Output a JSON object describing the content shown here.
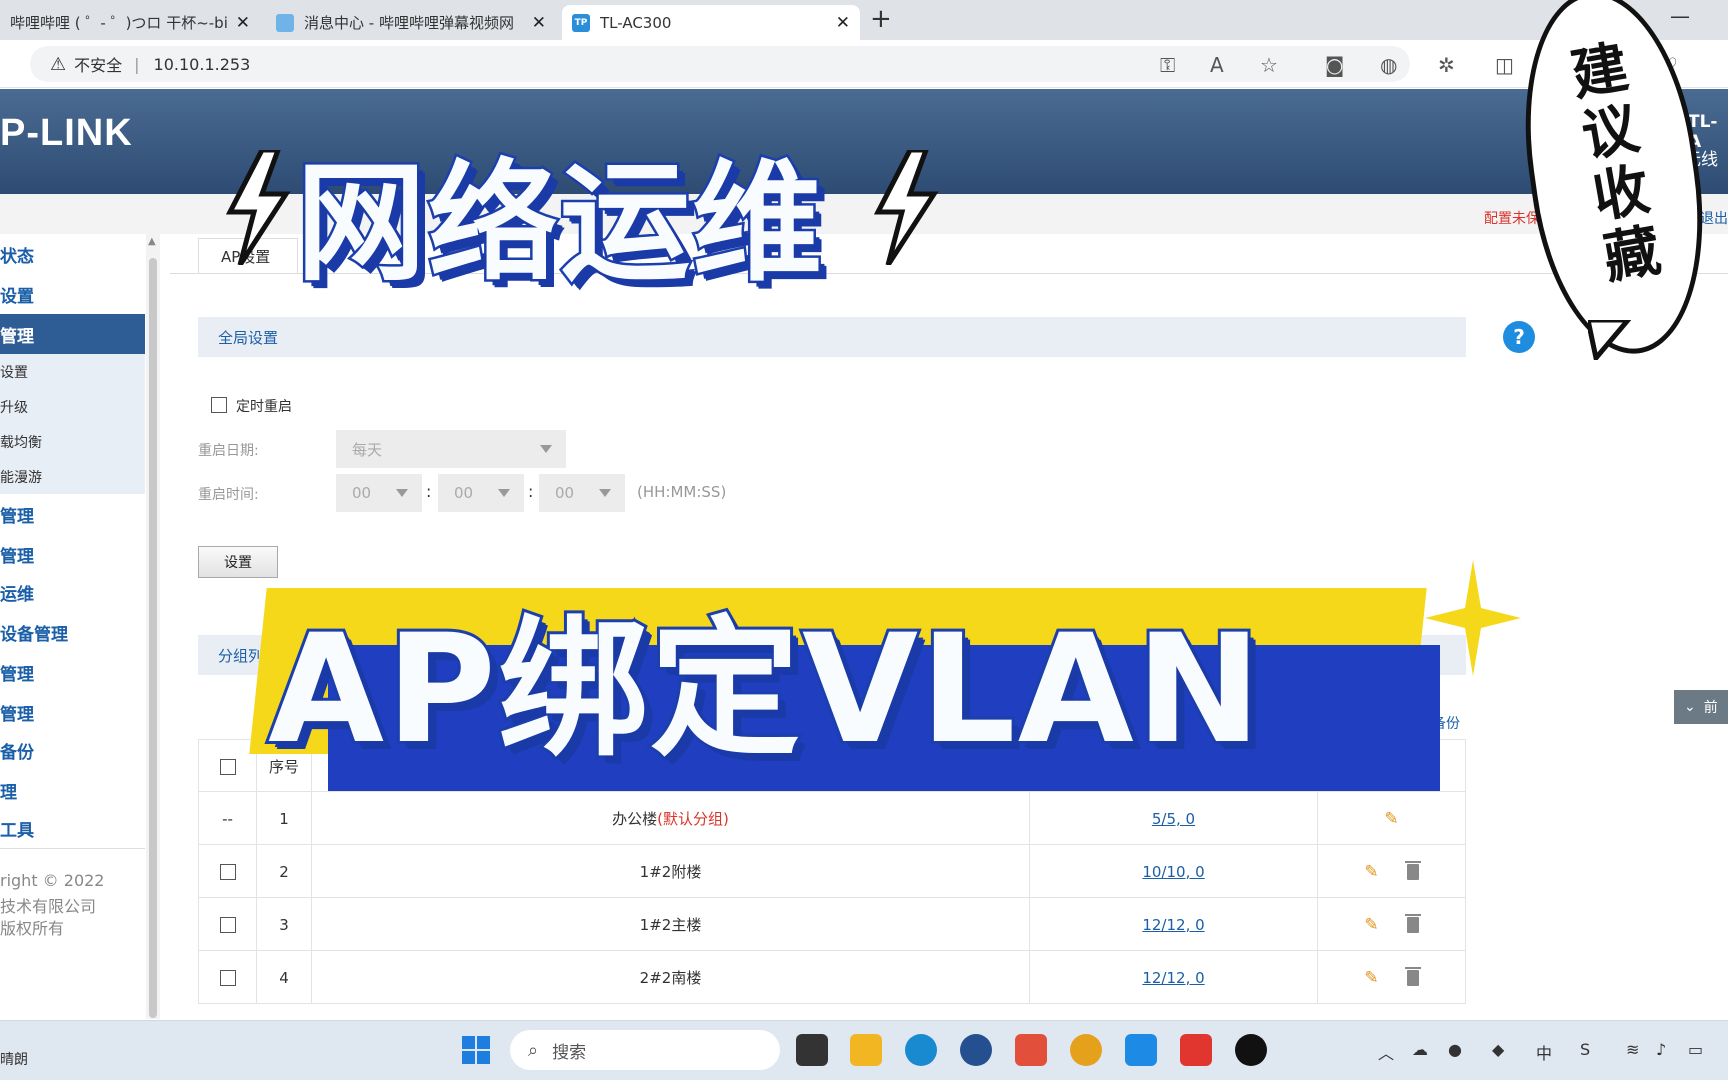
{
  "browser": {
    "tabs": [
      {
        "title": "哔哩哔哩 ( ゜- ゜)つロ 干杯~-bilib",
        "close": "✕"
      },
      {
        "title": "消息中心 - 哔哩哔哩弹幕视频网",
        "close": "✕"
      },
      {
        "title": "TL-AC300",
        "close": "✕",
        "favicon": "TP"
      }
    ],
    "new_tab": "+",
    "security_label": "不安全",
    "url": "10.10.1.253"
  },
  "router": {
    "logo": "P-LINK",
    "model": "TL-A",
    "model_sub": "无线",
    "unsaved": "配置未保存",
    "logout": "退出"
  },
  "sidebar": {
    "items": [
      "状态",
      "设置",
      "管理"
    ],
    "subitems": [
      "设置",
      "升级",
      "载均衡",
      "能漫游"
    ],
    "items2": [
      "管理",
      "管理",
      "运维",
      "设备管理",
      "管理",
      "管理",
      "备份",
      "理",
      "工具"
    ],
    "copyright": [
      "right © 2022",
      "技术有限公司",
      "版权所有"
    ]
  },
  "content": {
    "tab_label": "AP设置",
    "global_panel": "全局设置",
    "help": "?",
    "timed_reboot": "定时重启",
    "reboot_date_label": "重启日期:",
    "reboot_date_value": "每天",
    "reboot_time_label": "重启时间:",
    "time_h": "00",
    "time_m": "00",
    "time_s": "00",
    "colon": ":",
    "time_hint": "(HH:MM:SS)",
    "set_button": "设置",
    "group_panel": "分组列",
    "backup": "备份",
    "side_button": "前",
    "header_seq": "序号",
    "rows": [
      {
        "check": "--",
        "seq": "1",
        "name": "办公楼",
        "tag": "(默认分组)",
        "count": "5/5, 0"
      },
      {
        "check": "",
        "seq": "2",
        "name": "1#2附楼",
        "tag": "",
        "count": "10/10, 0"
      },
      {
        "check": "",
        "seq": "3",
        "name": "1#2主楼",
        "tag": "",
        "count": "12/12, 0"
      },
      {
        "check": "",
        "seq": "4",
        "name": "2#2南楼",
        "tag": "",
        "count": "12/12, 0"
      }
    ]
  },
  "overlay": {
    "title_top": "网络运维",
    "title_bottom": "AP绑定VLAN",
    "bubble": "建议收藏"
  },
  "taskbar": {
    "weather": "晴朗",
    "search_placeholder": "搜索",
    "ime": "中"
  },
  "colors": {
    "accent_blue": "#1a5fa8",
    "header_blue": "#2e4c73",
    "title_stroke": "#1c3fae",
    "highlight_yellow": "#f6d81a"
  }
}
